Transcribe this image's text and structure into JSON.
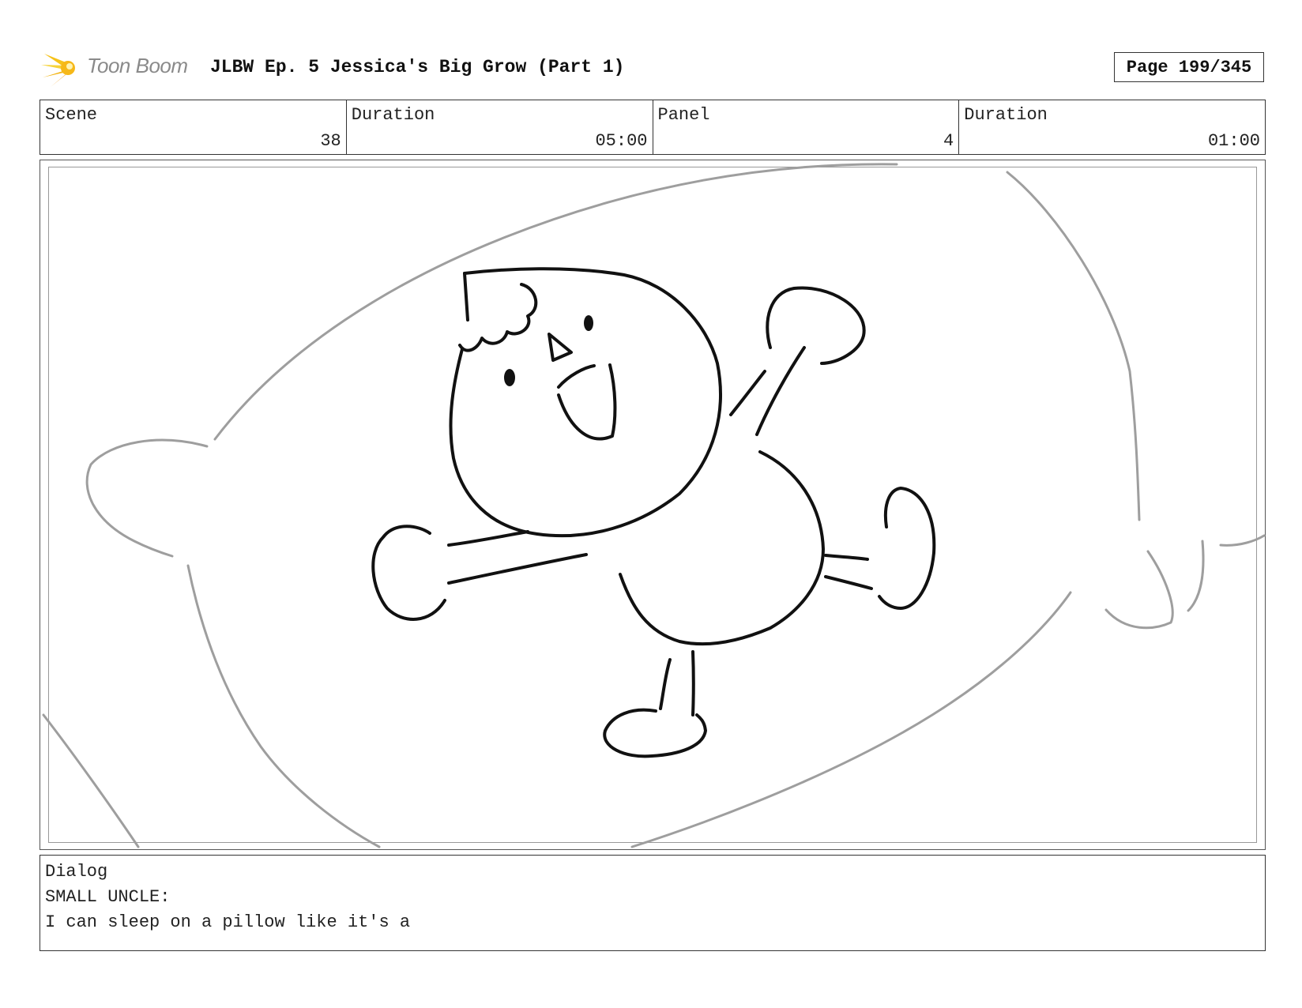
{
  "header": {
    "logo_text": "Toon Boom",
    "title": "JLBW Ep. 5 Jessica's Big Grow (Part 1)",
    "page": "Page 199/345"
  },
  "info": {
    "scene_label": "Scene",
    "scene_value": "38",
    "scene_duration_label": "Duration",
    "scene_duration_value": "05:00",
    "panel_label": "Panel",
    "panel_value": "4",
    "panel_duration_label": "Duration",
    "panel_duration_value": "01:00"
  },
  "dialog": {
    "label": "Dialog",
    "speaker": "SMALL UNCLE:",
    "line": "I can sleep on a pillow like it's a"
  },
  "colors": {
    "logo_yellow": "#f6c21a",
    "logo_orange": "#f39a12",
    "sketch_ink": "#111111",
    "sketch_pencil": "#9e9e9e"
  }
}
